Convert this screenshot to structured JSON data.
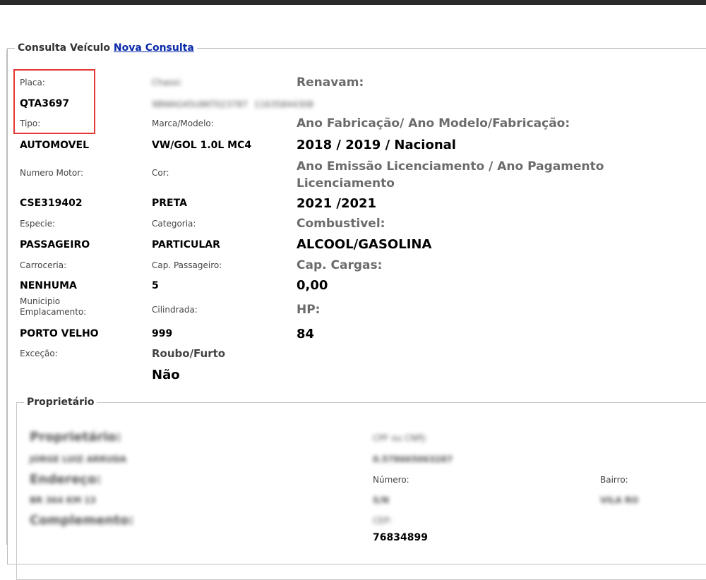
{
  "header": {
    "legend_text": "Consulta Veículo",
    "new_query_link": "Nova Consulta"
  },
  "vehicle": {
    "placa_label": "Placa:",
    "placa_value": "QTA3697",
    "chassi_label": "Chassi:",
    "chassi_value": "9BWAG45U8KT023787",
    "renavam_label": "Renavam:",
    "renavam_value": "11635844308",
    "tipo_label": "Tipo:",
    "tipo_value": "AUTOMOVEL",
    "marca_label": "Marca/Modelo:",
    "marca_value": "VW/GOL 1.0L MC4",
    "ano_label": "Ano Fabricação/ Ano Modelo/Fabricação:",
    "ano_value": "2018  / 2019  / Nacional",
    "motor_label": "Numero Motor:",
    "motor_value": "CSE319402",
    "cor_label": "Cor:",
    "cor_value": "PRETA",
    "licenciamento_label": "Ano Emissão Licenciamento / Ano Pagamento Licenciamento",
    "licenciamento_value": "2021  /2021",
    "especie_label": "Especie:",
    "especie_value": "PASSAGEIRO",
    "categoria_label": "Categoria:",
    "categoria_value": "PARTICULAR",
    "combustivel_label": "Combustivel:",
    "combustivel_value": "ALCOOL/GASOLINA",
    "carroceria_label": "Carroceria:",
    "carroceria_value": "NENHUMA",
    "cap_passageiro_label": "Cap. Passageiro:",
    "cap_passageiro_value": "5",
    "cap_cargas_label": "Cap. Cargas:",
    "cap_cargas_value": "0,00",
    "municipio_label": "Municipio Emplacamento:",
    "municipio_value": "PORTO VELHO",
    "cilindrada_label": "Cilindrada:",
    "cilindrada_value": "999",
    "hp_label": "HP:",
    "hp_value": "84",
    "excecao_label": "Exceção:",
    "roubo_label": "Roubo/Furto",
    "roubo_value": "Não"
  },
  "owner": {
    "legend": "Proprietário",
    "name_label": "Proprietário:",
    "name_value": "JORGE LUIZ ARRUDA",
    "cpf_label": "CPF ou CNPJ:",
    "cpf_value": "0.578665063287",
    "endereco_label": "Endereço:",
    "endereco_value": "BR 364 KM 13",
    "numero_label": "Número:",
    "numero_value": "S/N",
    "bairro_label": "Bairro:",
    "bairro_value": "VILA RO",
    "complemento_label": "Complemento:",
    "cep_label": "CEP:",
    "cep_value": "76834899"
  },
  "colors": {
    "link": "#0a2aa8",
    "highlight_border": "#e53935"
  }
}
